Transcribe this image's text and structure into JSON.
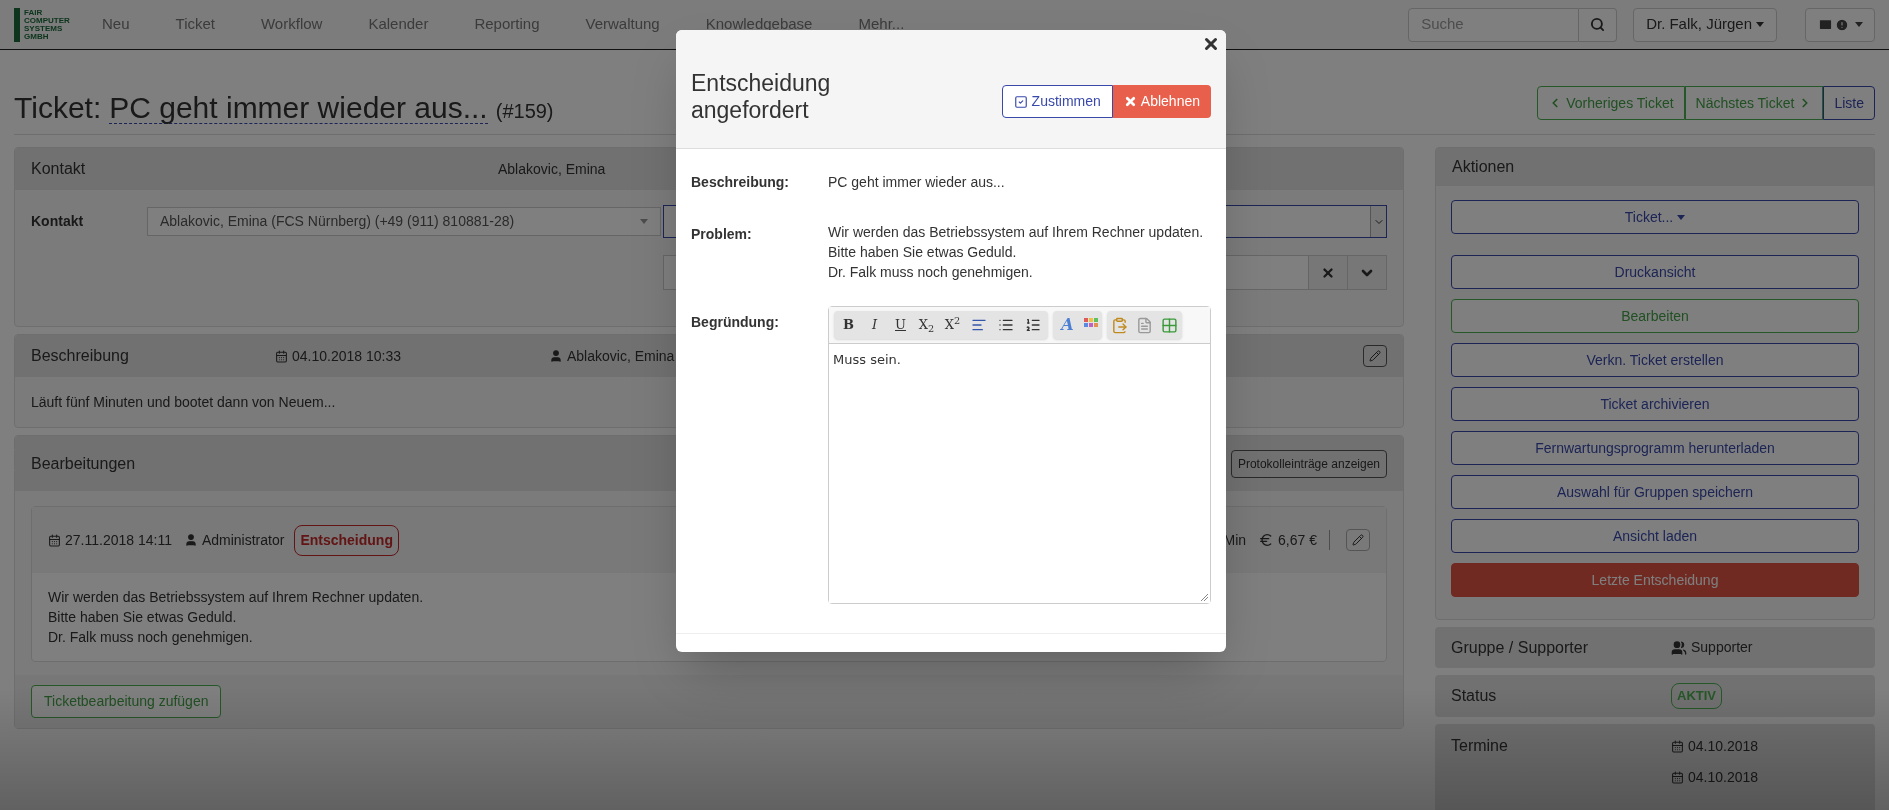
{
  "navbar": {
    "logo_lines": [
      "FAIR",
      "COMPUTER",
      "SYSTEMS",
      "GMBH"
    ],
    "items": [
      "Neu",
      "Ticket",
      "Workflow",
      "Kalender",
      "Reporting",
      "Verwaltung",
      "Knowledgebase",
      "Mehr..."
    ],
    "search": {
      "placeholder": "Suche"
    },
    "user": "Dr. Falk, Jürgen"
  },
  "title": {
    "prefix": "Ticket:",
    "subject": "PC geht immer wieder aus...",
    "number": "(#159)"
  },
  "pager": [
    {
      "label": "Vorheriges Ticket",
      "kind": "prev"
    },
    {
      "label": "Nächstes Ticket",
      "kind": "next"
    },
    {
      "label": "Liste",
      "kind": "list"
    }
  ],
  "kontakt": {
    "title": "Kontakt",
    "header_value": "Ablakovic, Emina",
    "label": "Kontakt",
    "value": "Ablakovic, Emina (FCS Nürnberg) (+49 (911) 810881-28)"
  },
  "beschreibung": {
    "title": "Beschreibung",
    "date": "04.10.2018 10:33",
    "author": "Ablakovic, Emina",
    "text": "Läuft fünf Minuten und bootet dann von Neuem..."
  },
  "bearbeitungen": {
    "title": "Bearbeitungen",
    "log_button": "Protokolleinträge anzeigen",
    "entry": {
      "date": "27.11.2018 14:11",
      "author": "Administrator",
      "badge": "Entscheidung",
      "duration": "Min",
      "cost": "6,67 €",
      "lines": [
        "Wir werden das Betriebssystem auf Ihrem Rechner updaten.",
        "Bitte haben Sie etwas Geduld.",
        "Dr. Falk muss noch genehmigen."
      ]
    },
    "add_button": "Ticketbearbeitung zufügen"
  },
  "aktionen": {
    "title": "Aktionen",
    "buttons": [
      {
        "label": "Ticket...",
        "kind": "dropdown"
      },
      {
        "label": "Druckansicht",
        "kind": "outline"
      },
      {
        "label": "Bearbeiten",
        "kind": "success"
      },
      {
        "label": "Verkn. Ticket erstellen",
        "kind": "outline"
      },
      {
        "label": "Ticket archivieren",
        "kind": "outline"
      },
      {
        "label": "Fernwartungsprogramm herunterladen",
        "kind": "outline"
      },
      {
        "label": "Auswahl für Gruppen speichern",
        "kind": "outline"
      },
      {
        "label": "Ansicht laden",
        "kind": "outline"
      },
      {
        "label": "Letzte Entscheidung",
        "kind": "danger"
      }
    ]
  },
  "gruppe": {
    "label": "Gruppe / Supporter",
    "value": "Supporter"
  },
  "status": {
    "label": "Status",
    "badge": "AKTIV"
  },
  "termine": {
    "label": "Termine",
    "dates": [
      "04.10.2018",
      "04.10.2018"
    ]
  },
  "modal": {
    "title": "Entscheidung angefordert",
    "approve": "Zustimmen",
    "reject": "Ablehnen",
    "description_label": "Beschreibung:",
    "description": "PC geht immer wieder aus...",
    "problem_label": "Problem:",
    "problem_lines": [
      "Wir werden das Betriebssystem auf Ihrem Rechner updaten.",
      "Bitte haben Sie etwas Geduld.",
      "Dr. Falk muss noch genehmigen."
    ],
    "reason_label": "Begründung:",
    "toolbar_text_buttons": [
      "B",
      "I",
      "U",
      "X$_{2}$",
      "X$^{2}$"
    ],
    "font_color_button": "A",
    "reason_value": "Muss sein."
  }
}
